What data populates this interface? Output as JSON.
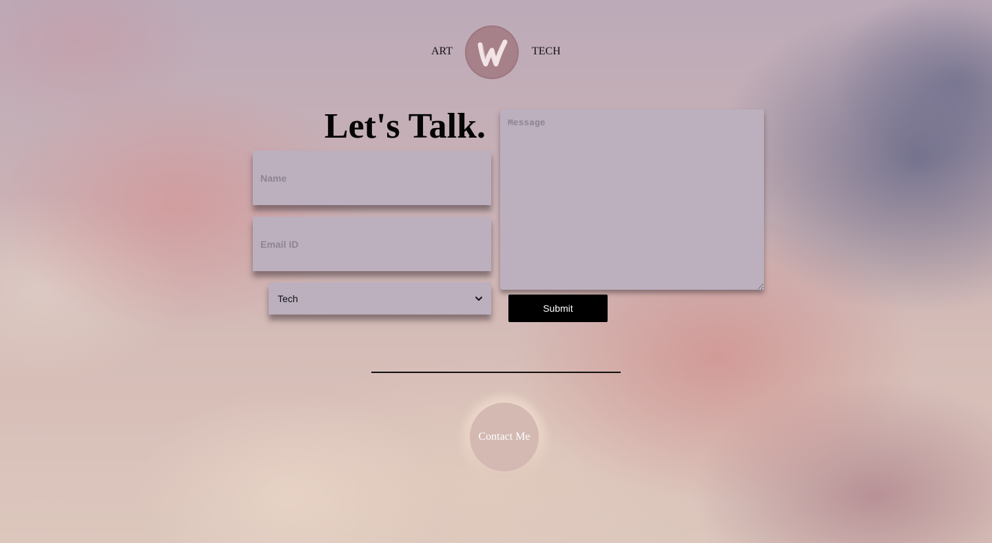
{
  "brand": {
    "left_text": "ART",
    "right_text": "TECH",
    "logo_icon": "w-brush-logo-icon",
    "logo_color": "#a7818a"
  },
  "form": {
    "heading": "Let's Talk.",
    "name_placeholder": "Name",
    "email_placeholder": "Email ID",
    "category_selected": "Tech",
    "category_options": [
      "Tech"
    ],
    "message_placeholder": "Message",
    "submit_label": "Submit",
    "field_color": "#bcb0bf"
  },
  "footer": {
    "contact_label": "Contact Me",
    "contact_color": "#d3b9b2"
  }
}
